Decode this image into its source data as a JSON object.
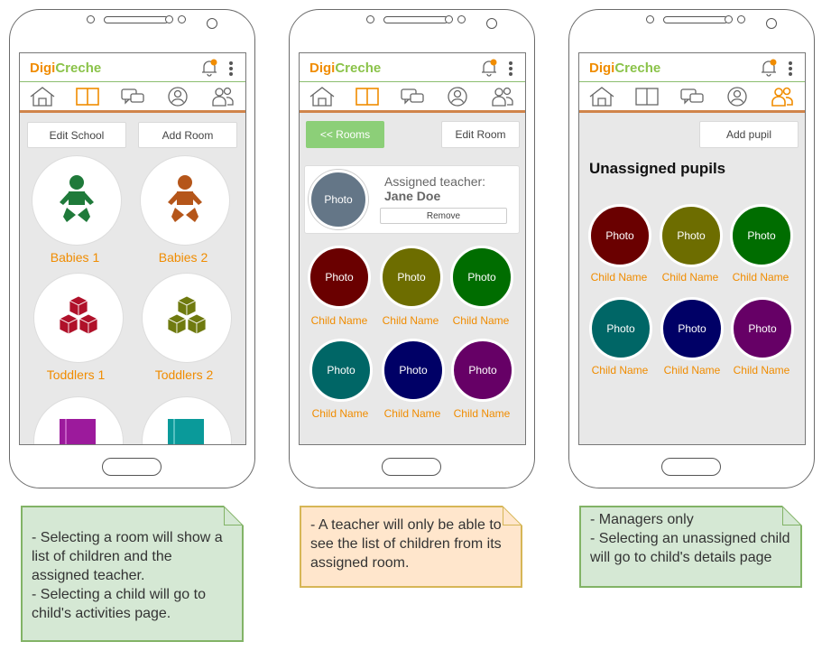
{
  "app": {
    "logo_part1": "Digi",
    "logo_part2": "Creche",
    "colors": {
      "brand_orange": "#f08c00",
      "brand_green": "#8bc34a",
      "nav_border": "#d0844a"
    },
    "nav_icons": [
      "home-icon",
      "book-icon",
      "chat-icon",
      "profile-icon",
      "group-icon"
    ]
  },
  "screen1": {
    "buttons": {
      "edit_school": "Edit School",
      "add_room": "Add Room"
    },
    "rooms": [
      {
        "name": "Babies 1",
        "icon": "baby-icon",
        "color": "#1f7a3a"
      },
      {
        "name": "Babies 2",
        "icon": "baby-icon",
        "color": "#b5561a"
      },
      {
        "name": "Toddlers 1",
        "icon": "blocks-icon",
        "color": "#b0112a"
      },
      {
        "name": "Toddlers 2",
        "icon": "blocks-icon",
        "color": "#6f7a0f"
      }
    ],
    "partial_rooms": [
      {
        "icon": "book-icon",
        "color": "#9c1a9c"
      },
      {
        "icon": "book-icon",
        "color": "#0a9a9a"
      }
    ]
  },
  "screen2": {
    "buttons": {
      "rooms": "<< Rooms",
      "edit_room": "Edit Room",
      "remove": "Remove"
    },
    "teacher": {
      "photo": "Photo",
      "label": "Assigned teacher:",
      "name": "Jane Doe",
      "photo_color": "#647687"
    },
    "children": [
      {
        "photo": "Photo",
        "name": "Child Name",
        "color": "#6a0000"
      },
      {
        "photo": "Photo",
        "name": "Child Name",
        "color": "#6d6d00"
      },
      {
        "photo": "Photo",
        "name": "Child Name",
        "color": "#006d00"
      },
      {
        "photo": "Photo",
        "name": "Child Name",
        "color": "#006666"
      },
      {
        "photo": "Photo",
        "name": "Child Name",
        "color": "#000066"
      },
      {
        "photo": "Photo",
        "name": "Child Name",
        "color": "#660066"
      }
    ]
  },
  "screen3": {
    "buttons": {
      "add_pupil": "Add pupil"
    },
    "heading": "Unassigned pupils",
    "children": [
      {
        "photo": "Photo",
        "name": "Child Name",
        "color": "#6a0000"
      },
      {
        "photo": "Photo",
        "name": "Child Name",
        "color": "#6d6d00"
      },
      {
        "photo": "Photo",
        "name": "Child Name",
        "color": "#006d00"
      },
      {
        "photo": "Photo",
        "name": "Child Name",
        "color": "#006666"
      },
      {
        "photo": "Photo",
        "name": "Child Name",
        "color": "#000066"
      },
      {
        "photo": "Photo",
        "name": "Child Name",
        "color": "#660066"
      }
    ]
  },
  "notes": [
    {
      "lines": [
        "- Selecting a room will show a list of children and the assigned teacher.",
        "- Selecting a child will go to child's activities page."
      ],
      "bg": "#d5e8d4",
      "border": "#82b366"
    },
    {
      "lines": [
        "- A teacher will only be able to see the list of children from its assigned room."
      ],
      "bg": "#ffe6cc",
      "border": "#d6b656"
    },
    {
      "lines": [
        "- Managers only",
        "- Selecting an unassigned child will go to child's details page"
      ],
      "bg": "#d5e8d4",
      "border": "#82b366"
    }
  ]
}
